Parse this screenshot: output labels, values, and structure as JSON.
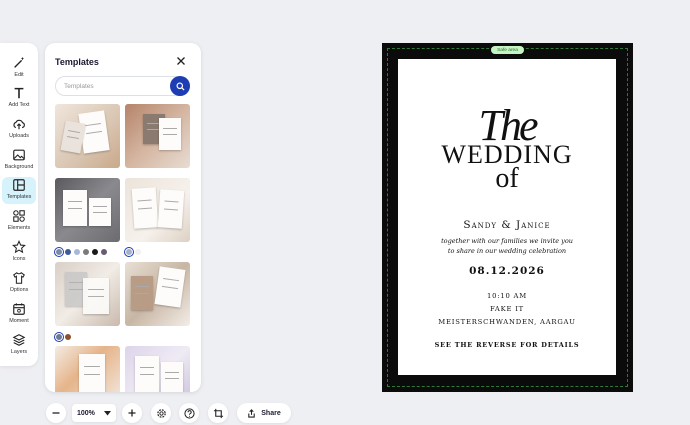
{
  "rail": {
    "items": [
      {
        "label": "Edit",
        "icon": "magic-wand-icon"
      },
      {
        "label": "Add Text",
        "icon": "text-icon"
      },
      {
        "label": "Uploads",
        "icon": "cloud-upload-icon"
      },
      {
        "label": "Background",
        "icon": "image-icon"
      },
      {
        "label": "Templates",
        "icon": "layout-icon"
      },
      {
        "label": "Elements",
        "icon": "shapes-icon"
      },
      {
        "label": "Icons",
        "icon": "star-icon"
      },
      {
        "label": "Options",
        "icon": "shirt-icon"
      },
      {
        "label": "Moment",
        "icon": "calendar-icon"
      },
      {
        "label": "Layers",
        "icon": "layers-icon"
      }
    ],
    "active": "Templates",
    "active_color": "#d6f3fb"
  },
  "panel": {
    "title": "Templates",
    "search_placeholder": "Templates",
    "search_button_color": "#1e3db3",
    "swatch_rows": [
      [
        "#7b8aa0",
        "#3d5a9e",
        "#a9b6d6",
        "#7a7a7a",
        "#1b1b1b",
        "#6a5a72"
      ],
      [
        "#a3b1c9",
        "#f0f0f0"
      ],
      [
        "#6e7a90",
        "#8a4f2c"
      ]
    ]
  },
  "toolbar": {
    "zoom": "100%",
    "share": "Share"
  },
  "canvas": {
    "safe_area": "Safe area",
    "the": "The",
    "wedding": "WEDDING",
    "of": "of",
    "names": "Sandy & Janice",
    "invite_line1": "together with our families we invite you",
    "invite_line2": "to share in our wedding celebration",
    "date": "08.12.2026",
    "time": "10:10 AM",
    "place": "FAKE IT",
    "location": "MEISTERSCHWANDEN, AARGAU",
    "reverse": "SEE THE REVERSE FOR DETAILS"
  }
}
